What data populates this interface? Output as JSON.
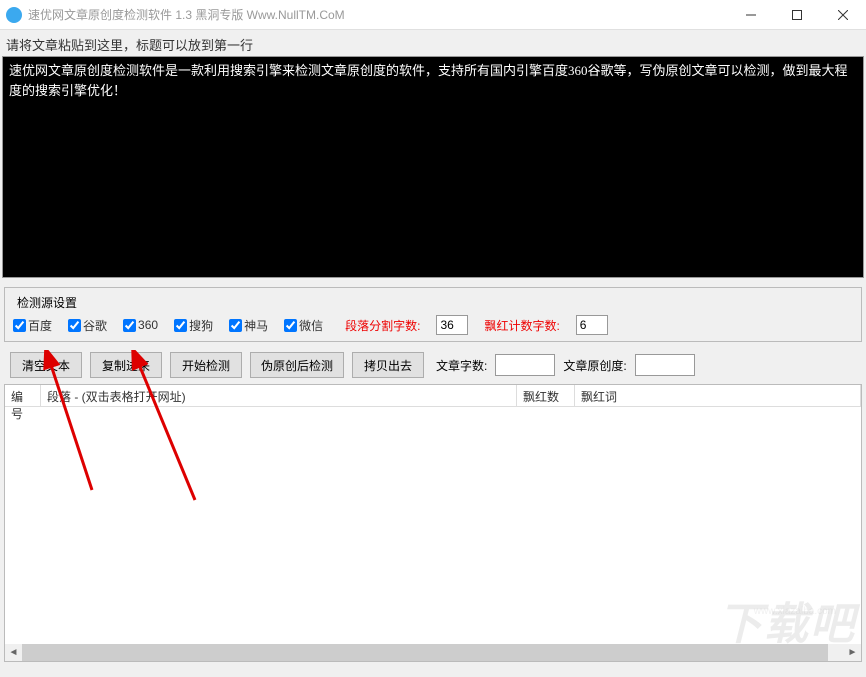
{
  "titlebar": {
    "title": "速优网文章原创度检测软件 1.3   黑洞专版 Www.NullTM.CoM"
  },
  "instruction": "请将文章粘贴到这里，标题可以放到第一行",
  "textarea_content": "速优网文章原创度检测软件是一款利用搜索引擎来检测文章原创度的软件，支持所有国内引擎百度360谷歌等，写伪原创文章可以检测，做到最大程度的搜索引擎优化！",
  "source_settings": {
    "legend": "检测源设置",
    "checkboxes": {
      "baidu": "百度",
      "google": "谷歌",
      "360": "360",
      "sogou": "搜狗",
      "shenma": "神马",
      "wechat": "微信"
    },
    "segment_label": "段落分割字数:",
    "segment_value": "36",
    "red_count_label": "飘红计数字数:",
    "red_count_value": "6"
  },
  "buttons": {
    "clear": "清空文本",
    "paste": "复制进来",
    "start": "开始检测",
    "pseudo": "伪原创后检测",
    "copy_out": "拷贝出去"
  },
  "stats": {
    "word_count_label": "文章字数:",
    "word_count_value": "",
    "originality_label": "文章原创度:",
    "originality_value": ""
  },
  "table": {
    "col1": "编号",
    "col2": "段落 - (双击表格打开网址)",
    "col3": "飘红数",
    "col4": "飘红词"
  },
  "watermark": "下载吧"
}
